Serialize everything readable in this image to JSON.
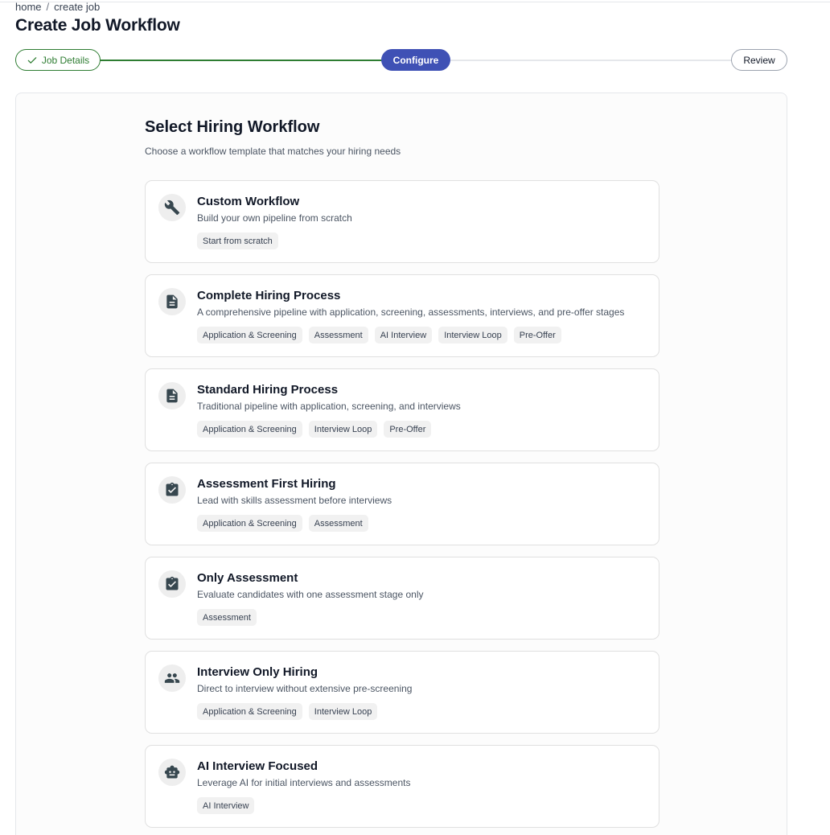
{
  "breadcrumb": {
    "home": "home",
    "separator": "/",
    "current": "create job"
  },
  "page_title": "Create Job Workflow",
  "stepper": {
    "steps": [
      {
        "label": "Job Details",
        "state": "done"
      },
      {
        "label": "Configure",
        "state": "active"
      },
      {
        "label": "Review",
        "state": "pending"
      }
    ],
    "colors": {
      "done": "#2e7d32",
      "active": "#3f51b5",
      "pending": "#9ca3af"
    }
  },
  "section": {
    "title": "Select Hiring Workflow",
    "subtitle": "Choose a workflow template that matches your hiring needs"
  },
  "workflows": [
    {
      "icon": "wrench-icon",
      "title": "Custom Workflow",
      "description": "Build your own pipeline from scratch",
      "tags": [
        "Start from scratch"
      ]
    },
    {
      "icon": "document-icon",
      "title": "Complete Hiring Process",
      "description": "A comprehensive pipeline with application, screening, assessments, interviews, and pre-offer stages",
      "tags": [
        "Application & Screening",
        "Assessment",
        "AI Interview",
        "Interview Loop",
        "Pre-Offer"
      ]
    },
    {
      "icon": "document-icon",
      "title": "Standard Hiring Process",
      "description": "Traditional pipeline with application, screening, and interviews",
      "tags": [
        "Application & Screening",
        "Interview Loop",
        "Pre-Offer"
      ]
    },
    {
      "icon": "clipboard-check-icon",
      "title": "Assessment First Hiring",
      "description": "Lead with skills assessment before interviews",
      "tags": [
        "Application & Screening",
        "Assessment"
      ]
    },
    {
      "icon": "clipboard-check-icon",
      "title": "Only Assessment",
      "description": "Evaluate candidates with one assessment stage only",
      "tags": [
        "Assessment"
      ]
    },
    {
      "icon": "people-icon",
      "title": "Interview Only Hiring",
      "description": "Direct to interview without extensive pre-screening",
      "tags": [
        "Application & Screening",
        "Interview Loop"
      ]
    },
    {
      "icon": "robot-icon",
      "title": "AI Interview Focused",
      "description": "Leverage AI for initial interviews and assessments",
      "tags": [
        "AI Interview"
      ]
    }
  ]
}
